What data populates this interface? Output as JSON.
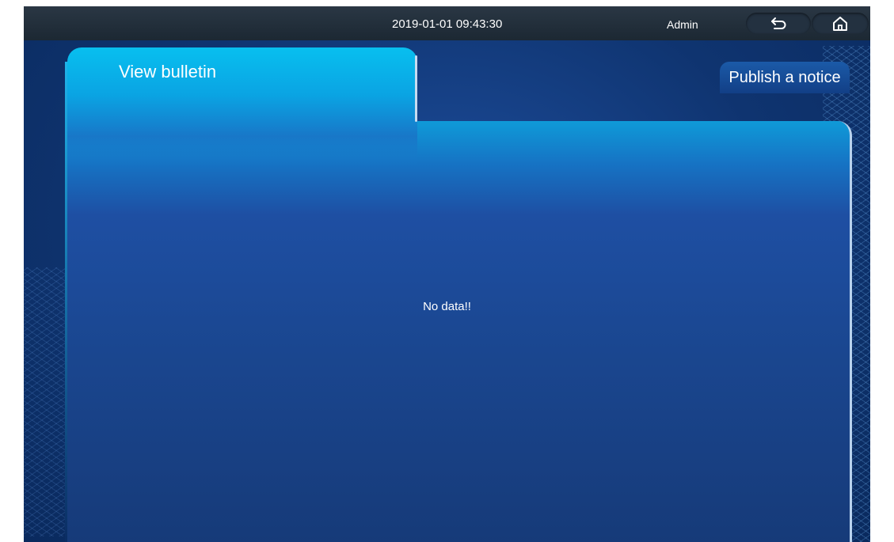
{
  "status_bar": {
    "datetime": "2019-01-01 09:43:30",
    "user": "Admin",
    "back_icon": "return-arrow-icon",
    "home_icon": "home-icon"
  },
  "tabs": [
    {
      "label": "View bulletin",
      "active": true
    },
    {
      "label": "Publish a notice",
      "active": false
    }
  ],
  "content": {
    "empty_message": "No data!!"
  },
  "colors": {
    "status_bar": "#1f2b36",
    "tab_active": "#08bfef",
    "background": "#0f3470"
  }
}
